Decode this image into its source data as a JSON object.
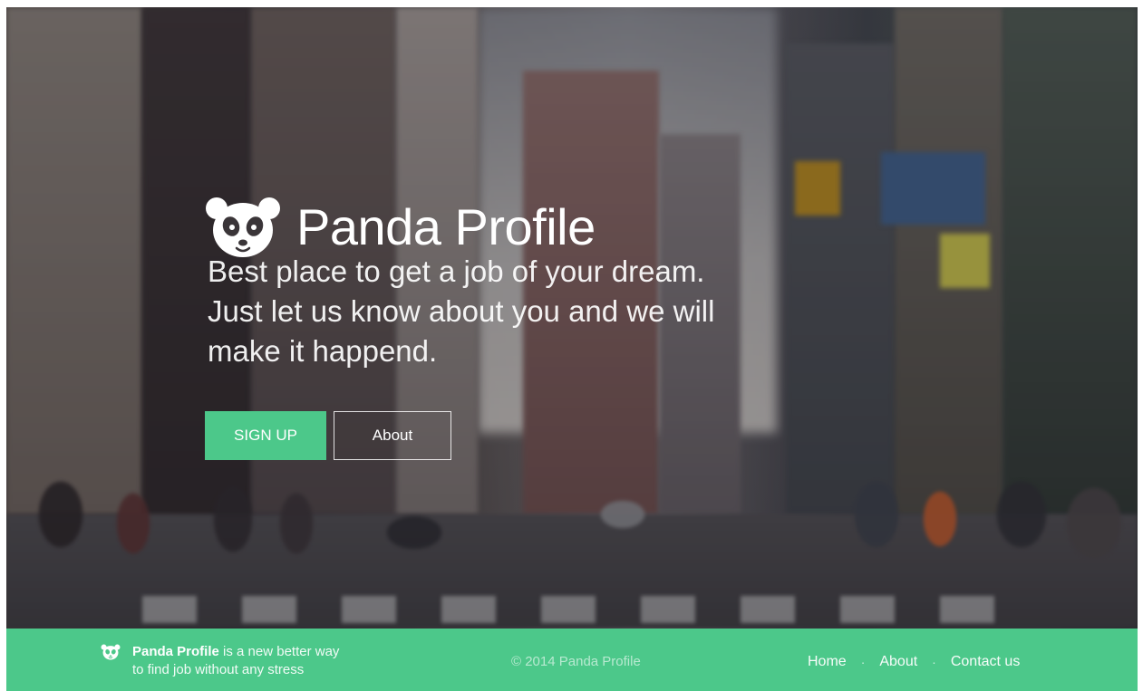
{
  "hero": {
    "brand_name": "Panda Profile",
    "tagline_lines": [
      "Best place to get a job of your dream.",
      "Just let us know about you and we will",
      "make it happend."
    ],
    "signup_label": "SIGN UP",
    "about_label": "About",
    "logo_icon": "panda-face-icon"
  },
  "footer": {
    "brand_name": "Panda Profile",
    "description_rest": " is a new better way",
    "description_line2": "to find job without any stress",
    "copyright": "© 2014 Panda Profile",
    "nav": [
      {
        "label": "Home"
      },
      {
        "label": "About"
      },
      {
        "label": "Contact us"
      }
    ],
    "separator": "·"
  },
  "colors": {
    "accent": "#4cc88a",
    "text": "#ffffff"
  }
}
